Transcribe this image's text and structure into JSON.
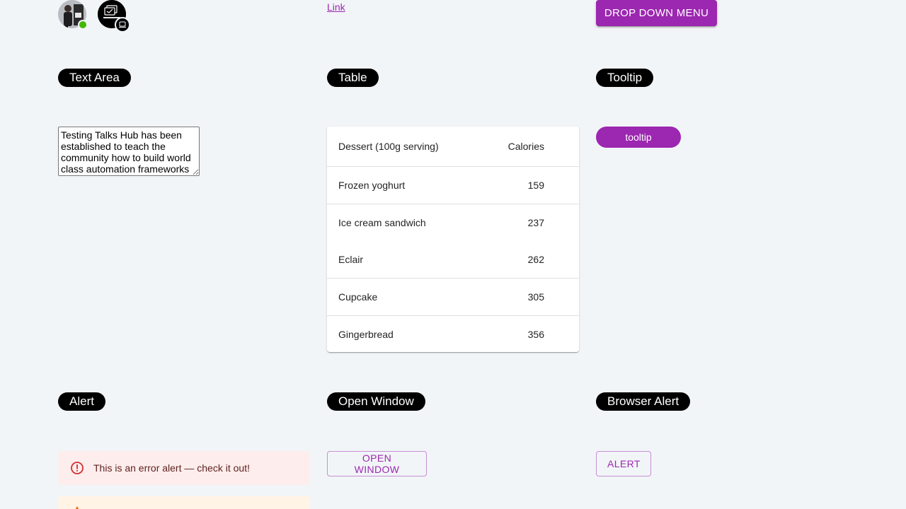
{
  "header": {
    "link_label": "Link",
    "dropdown_button_label": "DROP DOWN MENU"
  },
  "sections": {
    "text_area": "Text Area",
    "table": "Table",
    "tooltip": "Tooltip",
    "alert": "Alert",
    "open_window": "Open Window",
    "browser_alert": "Browser Alert"
  },
  "textarea": {
    "value": "Testing Talks Hub has been established to teach the community how to build world class automation frameworks"
  },
  "table": {
    "headers": [
      "Dessert (100g serving)",
      "Calories"
    ],
    "rows": [
      {
        "dessert": "Frozen yoghurt",
        "calories": "159"
      },
      {
        "dessert": "Ice cream sandwich",
        "calories": "237"
      },
      {
        "dessert": "Eclair",
        "calories": "262"
      },
      {
        "dessert": "Cupcake",
        "calories": "305"
      },
      {
        "dessert": "Gingerbread",
        "calories": "356"
      }
    ]
  },
  "tooltip": {
    "button_label": "tooltip"
  },
  "alerts": {
    "error_text": "This is an error alert — check it out!"
  },
  "buttons": {
    "open_window_label": "OPEN WINDOW",
    "alert_label": "ALERT"
  },
  "colors": {
    "accent": "#9c27b0",
    "background": "#f2f5f8",
    "status_online": "#44b700",
    "error_bg": "#fdeded",
    "warning_bg": "#fff4e5"
  },
  "icons": {
    "error": "error-outline-icon",
    "warning": "warning-icon"
  }
}
